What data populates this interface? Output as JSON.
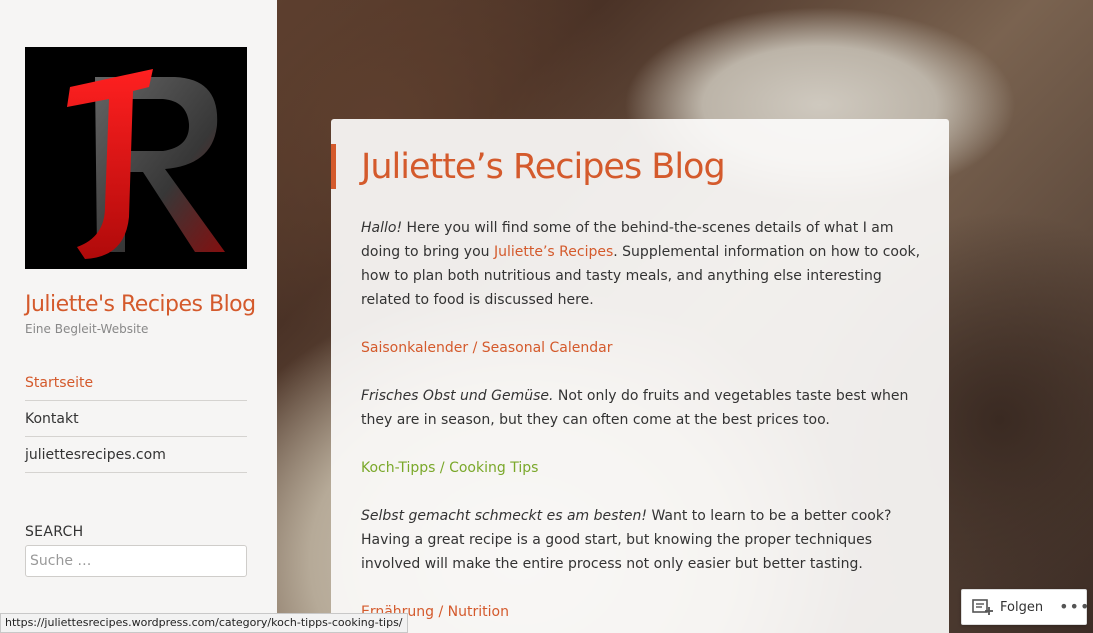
{
  "sidebar": {
    "logo_text": "JR",
    "site_title": "Juliette's Recipes Blog",
    "tagline": "Eine Begleit-Website",
    "menu": [
      {
        "label": "Startseite"
      },
      {
        "label": "Kontakt"
      },
      {
        "label": "juliettesrecipes.com"
      }
    ],
    "search": {
      "heading": "SEARCH",
      "placeholder": "Suche …"
    }
  },
  "main": {
    "title": "Juliette’s Recipes Blog",
    "intro_em": "Hallo!",
    "intro_before_link": " Here you will find some of the behind-the-scenes details of what I am doing to bring you ",
    "intro_link": "Juliette’s Recipes",
    "intro_after_link": ". Supplemental information on how to cook, how to plan both nutritious and tasty meals, and anything else interesting related to food is discussed here.",
    "sections": [
      {
        "link": "Saisonkalender / Seasonal Calendar",
        "em": "Frisches Obst und Gemüse.",
        "text": " Not only do fruits and vegetables taste best when they are in season, but they can often come at the best prices too."
      },
      {
        "link": "Koch-Tipps / Cooking Tips",
        "em": "Selbst gemacht schmeckt es am besten!",
        "text": " Want to learn to be a better cook? Having a great recipe is a good start, but knowing the proper techniques involved will make the entire process not only easier but better tasting."
      },
      {
        "link": "Ernährung / Nutrition"
      }
    ]
  },
  "statusbar": {
    "url": "https://juliettesrecipes.wordpress.com/category/koch-tipps-cooking-tips/"
  },
  "follow_widget": {
    "label": "Folgen",
    "more": "•••"
  },
  "colors": {
    "accent": "#d45a2c",
    "link_hover_green": "#7aa82a",
    "logo_red": "#d9141b"
  }
}
